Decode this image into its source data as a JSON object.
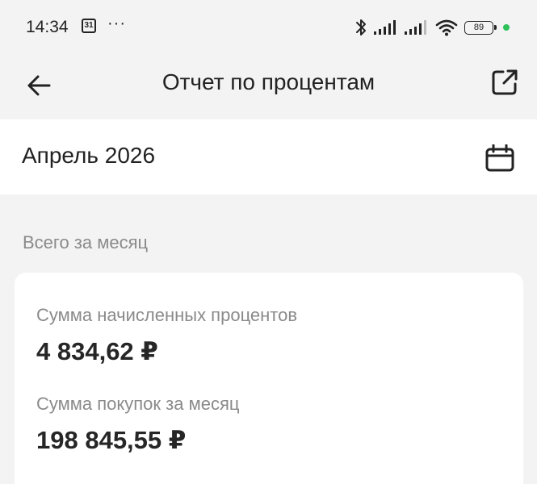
{
  "status_bar": {
    "time": "14:34",
    "calendar_day": "31",
    "dots": "···",
    "battery": "89",
    "icons": [
      "calendar-icon",
      "more-icon",
      "bluetooth-icon",
      "signal-icon",
      "signal-icon",
      "wifi-icon",
      "battery-icon",
      "dot-indicator"
    ],
    "dot_color": "#2ec15a"
  },
  "app_bar": {
    "title": "Отчет по процентам",
    "back_icon": "arrow-left-icon",
    "share_icon": "external-link-icon"
  },
  "month_selector": {
    "label": "Апрель 2026",
    "icon": "calendar-icon"
  },
  "summary": {
    "section_title": "Всего за месяц",
    "items": [
      {
        "label": "Сумма начисленных процентов",
        "value": "4 834,62 ₽"
      },
      {
        "label": "Сумма покупок за месяц",
        "value": "198 845,55 ₽"
      }
    ]
  }
}
